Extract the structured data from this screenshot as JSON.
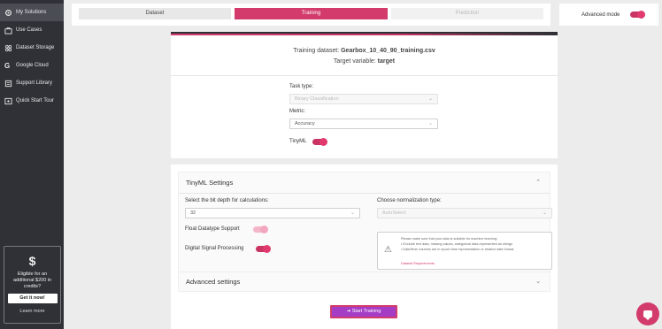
{
  "sidebar": {
    "items": [
      {
        "label": "My Solutions",
        "icon": "gear-icon",
        "active": true
      },
      {
        "label": "Use Cases",
        "icon": "briefcase-icon",
        "active": false
      },
      {
        "label": "Dataset Storage",
        "icon": "database-icon",
        "active": false
      },
      {
        "label": "Google Cloud",
        "icon": "google-icon",
        "active": false
      },
      {
        "label": "Support Library",
        "icon": "book-icon",
        "active": false
      },
      {
        "label": "Quick Start Tour",
        "icon": "tour-icon",
        "active": false
      }
    ],
    "promo": {
      "symbol": "$",
      "text": "Eligible for an additional $200 in credits?",
      "button": "Get it now!",
      "link": "Learn more"
    }
  },
  "stepper": {
    "steps": [
      "Dataset",
      "Training",
      "Prediction"
    ],
    "active": "Training"
  },
  "advanced_mode": {
    "label": "Advanced mode",
    "enabled": true
  },
  "training": {
    "dataset_label": "Training dataset:",
    "dataset_value": "Gearbox_10_40_90_training.csv",
    "target_label": "Target variable:",
    "target_value": "target",
    "task_type_label": "Task type:",
    "task_type_value": "Binary Classification",
    "metric_label": "Metric:",
    "metric_value": "Accuracy",
    "tinyml_label": "TinyML",
    "tinyml_enabled": true
  },
  "tinyml_settings": {
    "title": "TinyML Settings",
    "bit_depth_label": "Select the bit depth for calculations:",
    "bit_depth_value": "32",
    "normalization_label": "Choose normalization type:",
    "normalization_value": "AutoSelect",
    "float_label": "Float Datatype Support",
    "dsp_label": "Digital Signal Processing",
    "warning": {
      "line1": "Please make sure that your data is suitable for machine learning:",
      "line2": "• Exclude text data, missing values, categorical data represented as strings",
      "line3": "• Date/time columns are in epoch time representation or relative date format.",
      "link": "Dataset Requirements"
    }
  },
  "advanced_settings": {
    "title": "Advanced settings"
  },
  "start_button": {
    "label": "Start Training"
  },
  "colors": {
    "accent": "#d33b6c",
    "sidebar": "#2f3137",
    "button": "#a53cc6"
  }
}
